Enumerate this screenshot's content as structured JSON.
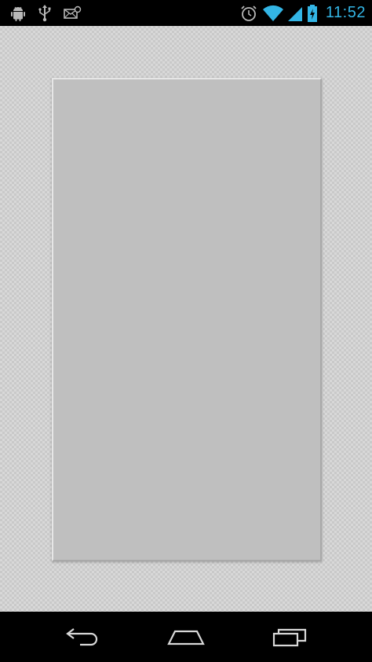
{
  "status_bar": {
    "time": "11:52",
    "left_icons": [
      "android-icon",
      "usb-icon",
      "mail-alert-icon"
    ],
    "right_icons": [
      "alarm-icon",
      "wifi-icon",
      "signal-icon",
      "battery-charging-icon"
    ],
    "accent_color": "#33b5e5"
  },
  "content": {
    "background": "checkerboard",
    "card_color": "#bfbfbf"
  },
  "nav_bar": {
    "buttons": [
      "back-icon",
      "home-icon",
      "recent-apps-icon"
    ]
  }
}
